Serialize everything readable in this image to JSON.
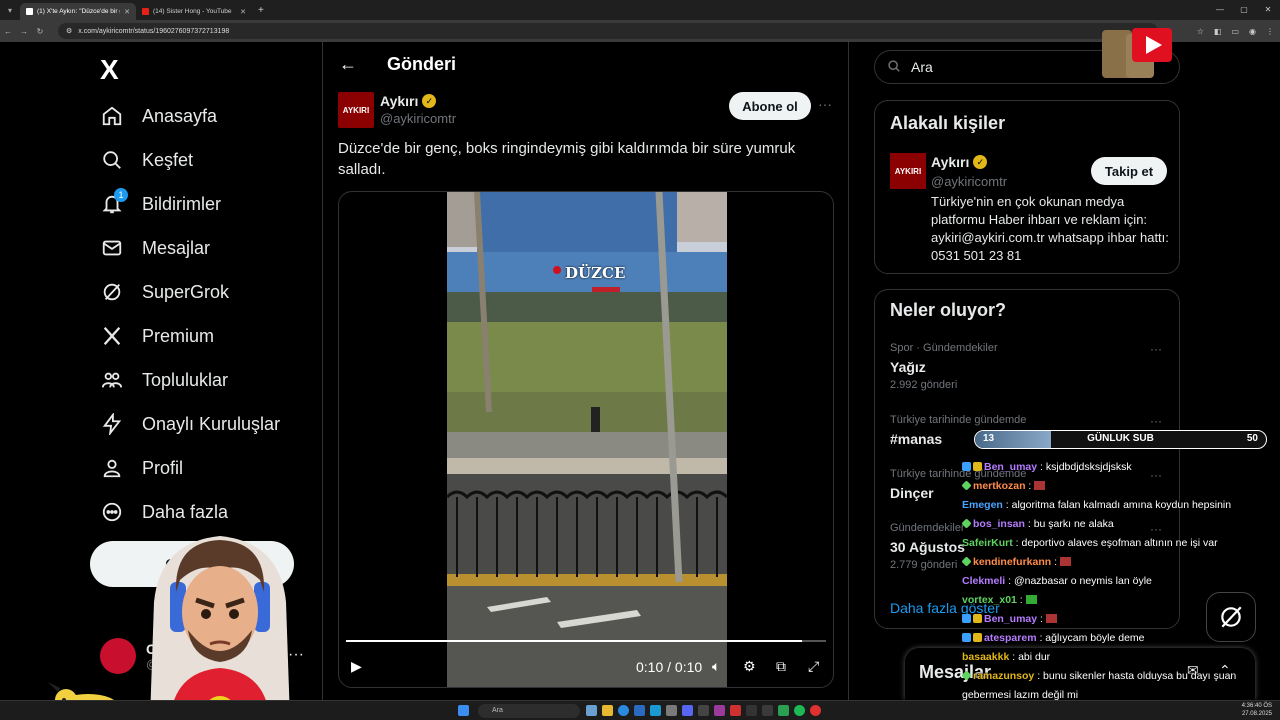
{
  "browser": {
    "tabs": [
      {
        "title": "(1) X'te Aykırı: \"Düzce'de bir genç",
        "active": true
      },
      {
        "title": "(14) Sister Hong - YouTube",
        "active": false
      }
    ],
    "new_tab": "+",
    "url": "x.com/aykiricomtr/status/1960276097372713198"
  },
  "nav": {
    "logo": "X",
    "items": [
      {
        "label": "Anasayfa",
        "icon": "home-icon"
      },
      {
        "label": "Keşfet",
        "icon": "search-icon"
      },
      {
        "label": "Bildirimler",
        "icon": "bell-icon",
        "badge": "1"
      },
      {
        "label": "Mesajlar",
        "icon": "mail-icon"
      },
      {
        "label": "SuperGrok",
        "icon": "grok-icon"
      },
      {
        "label": "Premium",
        "icon": "x-premium-icon"
      },
      {
        "label": "Topluluklar",
        "icon": "communities-icon"
      },
      {
        "label": "Onaylı Kuruluşlar",
        "icon": "lightning-icon"
      },
      {
        "label": "Profil",
        "icon": "person-icon"
      },
      {
        "label": "Daha fazla",
        "icon": "more-circle-icon"
      }
    ],
    "post_button": "Gönder",
    "user_name": "C",
    "user_handle": "@c"
  },
  "main": {
    "title": "Gönderi",
    "post": {
      "avatar_text": "AYKIRI",
      "name": "Aykırı",
      "handle": "@aykiricomtr",
      "subscribe": "Abone ol",
      "text": "Düzce'de bir genç, boks ringindeymiş gibi kaldırımda bir süre yumruk salladı.",
      "video_caption": "DÜZCE",
      "progress": 0.95,
      "time": "0:10 / 0:10"
    }
  },
  "right": {
    "search_placeholder": "Ara",
    "related": {
      "title": "Alakalı kişiler",
      "avatar_text": "AYKIRI",
      "name": "Aykırı",
      "handle": "@aykiricomtr",
      "follow": "Takip et",
      "bio": "Türkiye'nin en çok okunan medya platformu Haber ihbarı ve reklam için: aykiri@aykiri.com.tr whatsapp ihbar hattı: 0531 501 23 81"
    },
    "trends": {
      "title": "Neler oluyor?",
      "items": [
        {
          "category": "Spor · Gündemdekiler",
          "name": "Yağız",
          "count": "2.992 gönderi"
        },
        {
          "category": "Türkiye tarihinde gündemde",
          "name": "#manas",
          "count": ""
        },
        {
          "category": "Türkiye tarihinde gündemde",
          "name": "Dinçer",
          "count": ""
        },
        {
          "category": "Gündemdekiler",
          "name": "30 Ağustos",
          "count": "2.779 gönderi"
        }
      ],
      "show_more": "Daha fazla göster"
    },
    "messages": "Mesajlar"
  },
  "overlay": {
    "subgoal": {
      "label": "GÜNLUK SUB",
      "current": "13",
      "target": "50",
      "fill": 0.26
    },
    "chat": [
      {
        "user": "Ben_umay",
        "color": "#b57cff",
        "badges": [
          "b1",
          "b2"
        ],
        "msg": "ksjdbdjdsksjdjsksk",
        "emote": ""
      },
      {
        "user": "mertkozan",
        "color": "#ff8c4a",
        "badges": [
          "b3"
        ],
        "msg": "",
        "emote": "r"
      },
      {
        "user": "Emegen",
        "color": "#4aa3ff",
        "badges": [],
        "msg": "algoritma falan kalmadı amına koydun hepsinin",
        "emote": ""
      },
      {
        "user": "bos_insan",
        "color": "#b57cff",
        "badges": [
          "b3"
        ],
        "msg": "bu şarkı ne alaka",
        "emote": ""
      },
      {
        "user": "SafeirKurt",
        "color": "#5fd35f",
        "badges": [],
        "msg": "deportivo alaves eşofman altının ne işi var",
        "emote": ""
      },
      {
        "user": "kendinefurkann",
        "color": "#ff8c4a",
        "badges": [
          "b3"
        ],
        "msg": "",
        "emote": "r"
      },
      {
        "user": "Clekmeli",
        "color": "#b57cff",
        "badges": [],
        "msg": "@nazbasar o neymis lan öyle",
        "emote": ""
      },
      {
        "user": "vortex_x01",
        "color": "#5fd35f",
        "badges": [],
        "msg": "",
        "emote": "g"
      },
      {
        "user": "Ben_umay",
        "color": "#b57cff",
        "badges": [
          "b1",
          "b2"
        ],
        "msg": "",
        "emote": "r"
      },
      {
        "user": "atesparem",
        "color": "#b57cff",
        "badges": [
          "b1",
          "b2"
        ],
        "msg": "ağlıycam böyle deme",
        "emote": ""
      },
      {
        "user": "basaakkk",
        "color": "#e2b719",
        "badges": [],
        "msg": "abi dur",
        "emote": ""
      },
      {
        "user": "ramazunsoy",
        "color": "#e2b719",
        "badges": [
          "b3"
        ],
        "msg": "bunu sikenler hasta olduysa bu dayı şuan",
        "emote": ""
      },
      {
        "user": "",
        "color": "#fff",
        "badges": [],
        "msg": "gebermesi lazım değil mi",
        "emote": ""
      }
    ]
  },
  "taskbar": {
    "search": "Ara",
    "time": "4:36:40 ÖS",
    "date": "27.08.2025"
  },
  "colors": {
    "accent": "#1d9bf0",
    "verified": "#e2b719",
    "bg": "#000000"
  }
}
